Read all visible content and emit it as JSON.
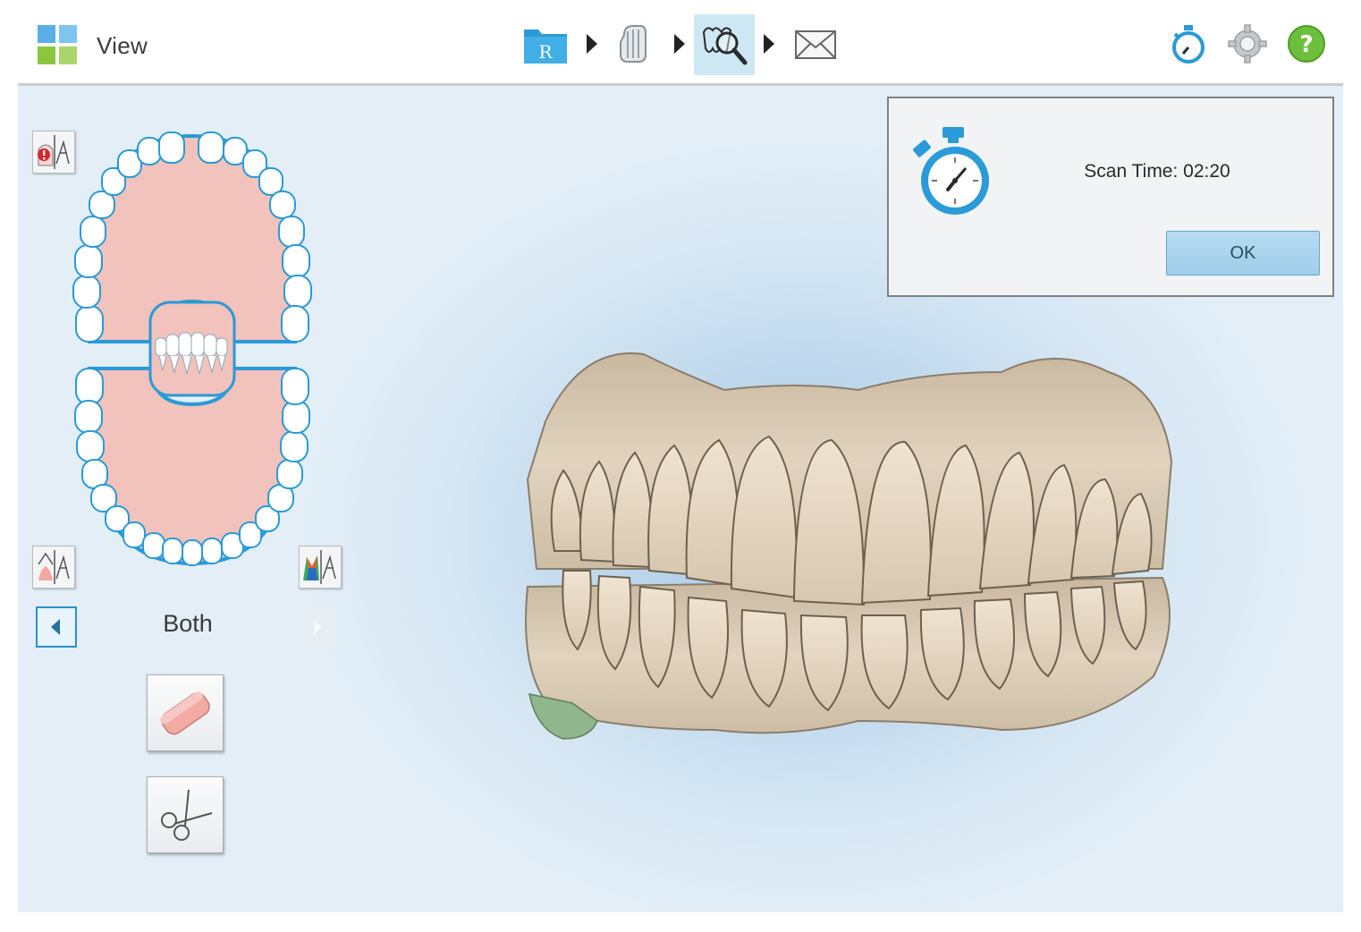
{
  "header": {
    "title": "View",
    "logo_icon": "app-grid-logo-icon",
    "workflow": [
      {
        "name": "rx-folder-icon",
        "glyph": "R"
      },
      {
        "name": "scan-icon"
      },
      {
        "name": "view-icon",
        "active": true
      },
      {
        "name": "send-icon"
      }
    ],
    "right_icons": [
      "stopwatch-icon",
      "settings-gear-icon",
      "help-icon"
    ]
  },
  "colors": {
    "accent_blue": "#2a9ad8",
    "help_green": "#6cbf3b",
    "gum_pink": "#f2c2bc",
    "model_beige": "#d9cab4",
    "highlight_green": "#8fb68c"
  },
  "sidebar": {
    "jaw_selection": "Both",
    "buttons": [
      "warning-layer-icon",
      "margin-layer-icon",
      "color-layer-icon"
    ],
    "tools": [
      "eraser-icon",
      "scissors-icon"
    ]
  },
  "dialog": {
    "icon": "stopwatch-icon",
    "message": "Scan Time: 02:20",
    "ok_label": "OK"
  }
}
